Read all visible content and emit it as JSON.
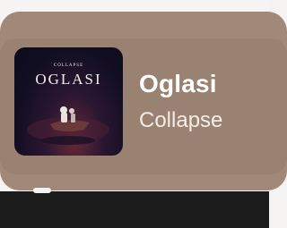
{
  "now_playing": {
    "title": "Oglasi",
    "artist": "Collapse",
    "artwork": {
      "artist_text": "COLLAPSE",
      "title_text": "OGLASI"
    }
  },
  "colors": {
    "card": "#a18979",
    "card_inner": "#9a8272",
    "bottom_bar": "#1b1b1b"
  },
  "icons": {
    "indicator": "page-indicator"
  }
}
